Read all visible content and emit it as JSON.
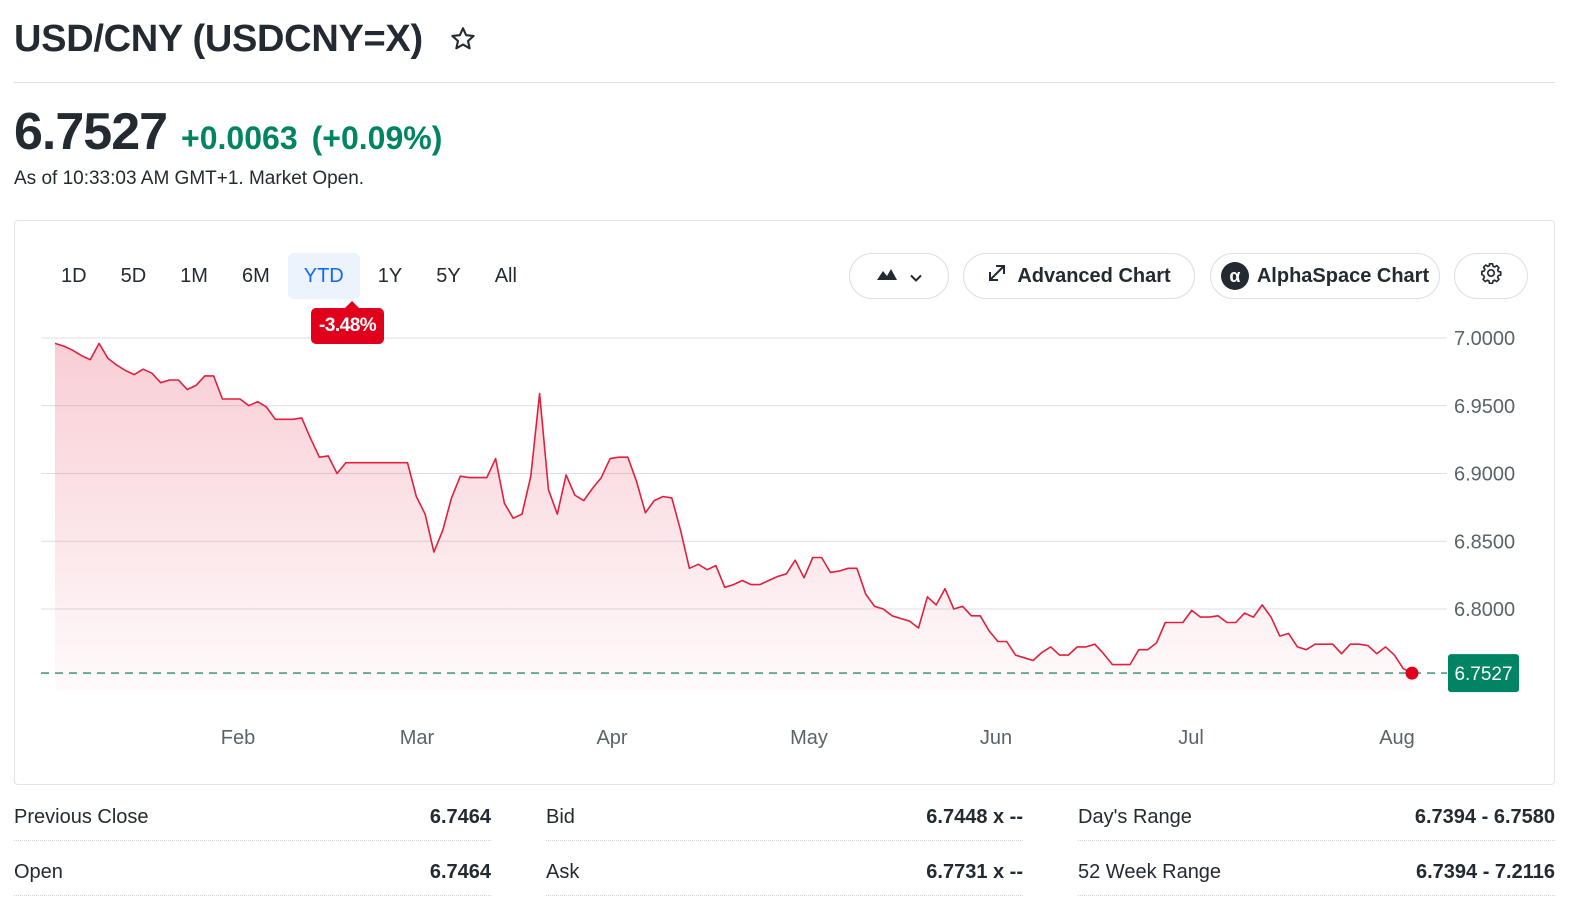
{
  "header": {
    "title": "USD/CNY (USDCNY=X)",
    "price": "6.7527",
    "change": "+0.0063",
    "change_pct": "(+0.09%)",
    "as_of": "As of 10:33:03 AM GMT+1. Market Open."
  },
  "colors": {
    "up": "#008463",
    "down": "#e0001b",
    "line": "#e0203f",
    "accent": "#0f69ff"
  },
  "range_tabs": [
    "1D",
    "5D",
    "1M",
    "6M",
    "YTD",
    "1Y",
    "5Y",
    "All"
  ],
  "active_range": "YTD",
  "ytd_change": "-3.48%",
  "toolbar": {
    "chart_type_icon": "mountain-chart-icon",
    "advanced_chart": "Advanced Chart",
    "alphaspace_chart": "AlphaSpace Chart",
    "alpha_symbol": "α",
    "settings_icon": "gear-icon"
  },
  "chart_data": {
    "type": "area",
    "y_ticks": [
      "7.0000",
      "6.9500",
      "6.9000",
      "6.8500",
      "6.8000"
    ],
    "ylim": [
      6.733,
      7.005
    ],
    "x_tick_labels": [
      "Feb",
      "Mar",
      "Apr",
      "May",
      "Jun",
      "Jul",
      "Aug"
    ],
    "last_value_label": "6.7527",
    "last_value": 6.7527,
    "series": [
      {
        "values": [
          6.996,
          6.994,
          6.991,
          6.987,
          6.984,
          6.996,
          6.985,
          6.98,
          6.976,
          6.973,
          6.977,
          6.974,
          6.967,
          6.969,
          6.969,
          6.962,
          6.965,
          6.972,
          6.972,
          6.955,
          6.955,
          6.955,
          6.95,
          6.953,
          6.949,
          6.94,
          6.94,
          6.94,
          6.941,
          6.926,
          6.912,
          6.913,
          6.9,
          6.908,
          6.908,
          6.908,
          6.908,
          6.908,
          6.908,
          6.908,
          6.908,
          6.883,
          6.87,
          6.842,
          6.858,
          6.882,
          6.898,
          6.897,
          6.897,
          6.897,
          6.911,
          6.878,
          6.867,
          6.87,
          6.898,
          6.959,
          6.888,
          6.87,
          6.899,
          6.884,
          6.88,
          6.889,
          6.897,
          6.911,
          6.912,
          6.912,
          6.894,
          6.871,
          6.88,
          6.883,
          6.882,
          6.858,
          6.83,
          6.833,
          6.829,
          6.832,
          6.816,
          6.818,
          6.821,
          6.818,
          6.818,
          6.821,
          6.824,
          6.826,
          6.836,
          6.823,
          6.838,
          6.838,
          6.827,
          6.828,
          6.83,
          6.83,
          6.811,
          6.802,
          6.8,
          6.795,
          6.793,
          6.791,
          6.786,
          6.809,
          6.803,
          6.815,
          6.8,
          6.802,
          6.795,
          6.795,
          6.784,
          6.776,
          6.776,
          6.766,
          6.764,
          6.762,
          6.768,
          6.772,
          6.766,
          6.766,
          6.772,
          6.772,
          6.774,
          6.767,
          6.759,
          6.759,
          6.759,
          6.77,
          6.77,
          6.775,
          6.79,
          6.79,
          6.79,
          6.799,
          6.794,
          6.794,
          6.795,
          6.79,
          6.79,
          6.797,
          6.794,
          6.803,
          6.794,
          6.78,
          6.782,
          6.772,
          6.77,
          6.774,
          6.774,
          6.774,
          6.767,
          6.774,
          6.774,
          6.773,
          6.767,
          6.772,
          6.766,
          6.756,
          6.7527
        ]
      }
    ]
  },
  "stats": [
    {
      "label": "Previous Close",
      "value": "6.7464"
    },
    {
      "label": "Open",
      "value": "6.7464"
    },
    {
      "label": "Bid",
      "value": "6.7448 x --"
    },
    {
      "label": "Ask",
      "value": "6.7731 x --"
    },
    {
      "label": "Day's Range",
      "value": "6.7394 - 6.7580"
    },
    {
      "label": "52 Week Range",
      "value": "6.7394 - 7.2116"
    }
  ]
}
